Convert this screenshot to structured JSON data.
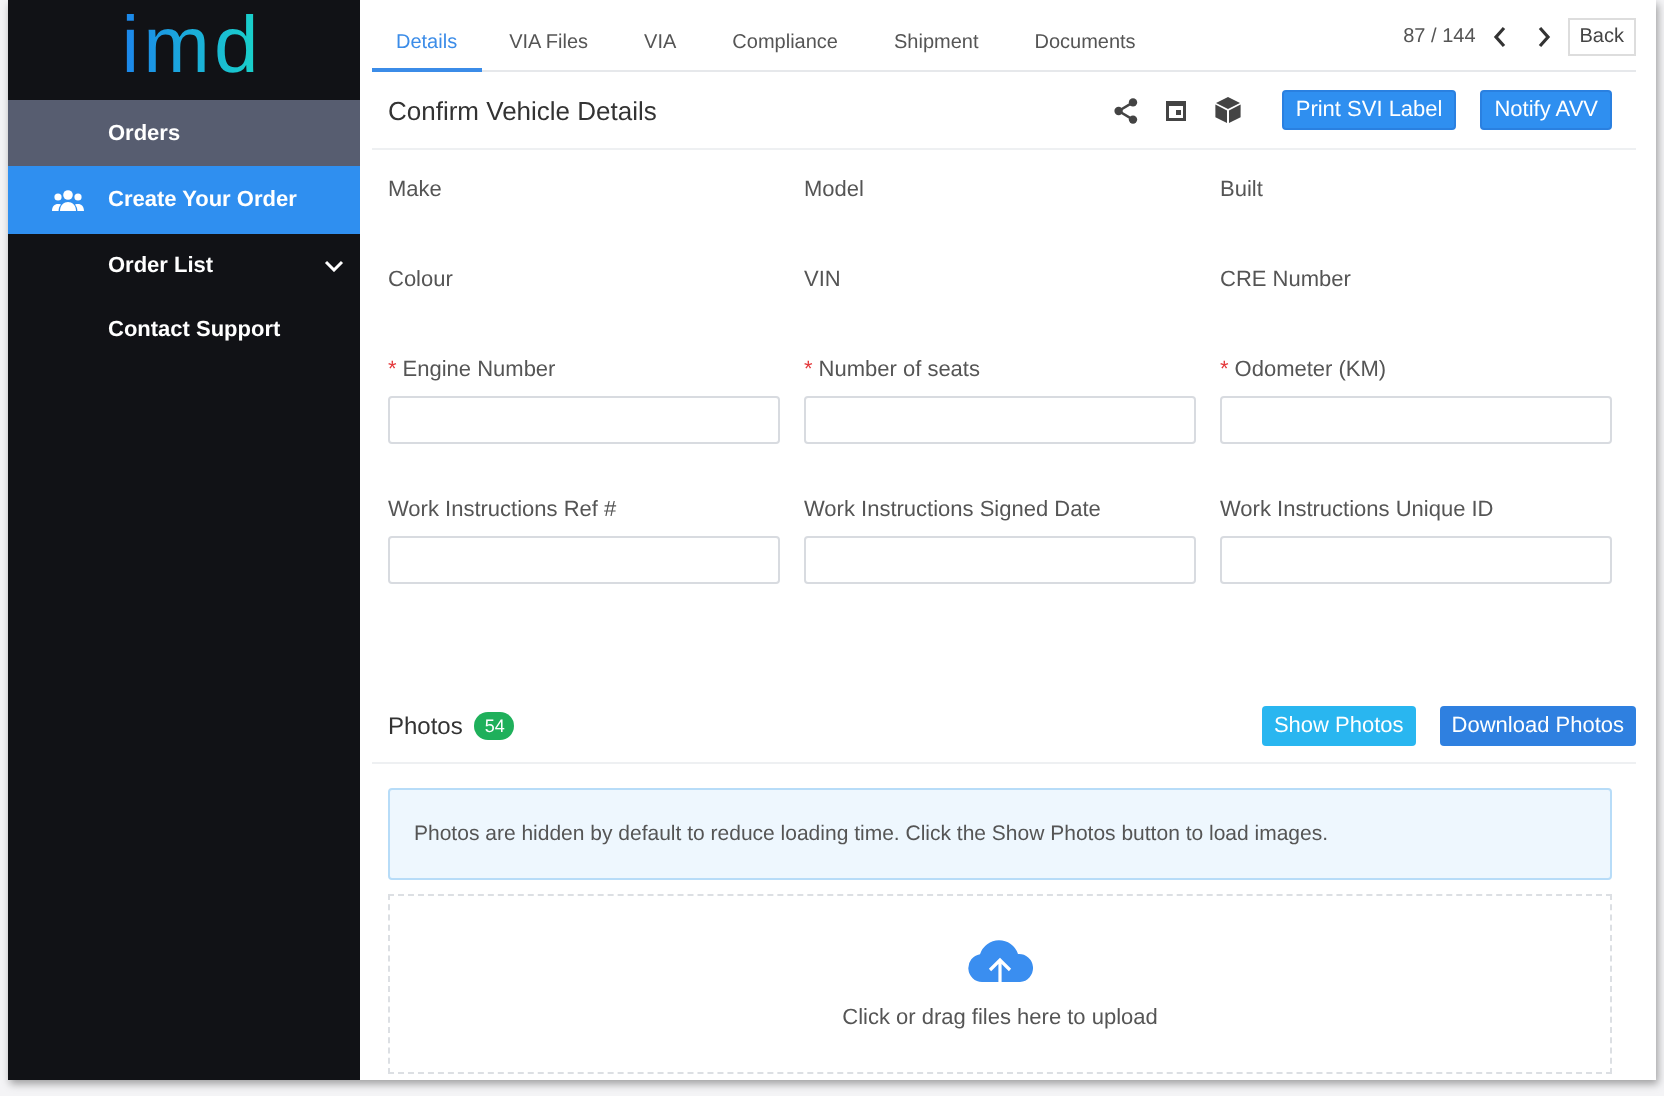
{
  "sidebar": {
    "logo": "imd",
    "items": [
      {
        "label": "Orders",
        "kind": "header",
        "selected": false
      },
      {
        "label": "Create Your Order",
        "kind": "icon-link",
        "selected": true
      },
      {
        "label": "Order List",
        "kind": "group",
        "selected": false,
        "expanded": false
      },
      {
        "label": "Contact Support",
        "kind": "link",
        "selected": false
      }
    ]
  },
  "tabs": [
    {
      "label": "Details",
      "selected": true
    },
    {
      "label": "VIA Files",
      "selected": false
    },
    {
      "label": "VIA",
      "selected": false
    },
    {
      "label": "Compliance",
      "selected": false
    },
    {
      "label": "Shipment",
      "selected": false
    },
    {
      "label": "Documents",
      "selected": false
    }
  ],
  "pager": {
    "position": "87 / 144",
    "back": "Back"
  },
  "header": {
    "title": "Confirm Vehicle Details",
    "buttons": [
      "Print SVI Label",
      "Notify AVV"
    ]
  },
  "fields": [
    {
      "label": "Make",
      "kind": "static",
      "required": false
    },
    {
      "label": "Model",
      "kind": "static",
      "required": false
    },
    {
      "label": "Built",
      "kind": "static",
      "required": false
    },
    {
      "label": "Colour",
      "kind": "static",
      "required": false
    },
    {
      "label": "VIN",
      "kind": "static",
      "required": false
    },
    {
      "label": "CRE Number",
      "kind": "static",
      "required": false
    },
    {
      "label": "Engine Number",
      "kind": "input",
      "required": true,
      "marker": "*"
    },
    {
      "label": "Number of seats",
      "kind": "input",
      "required": true,
      "marker": "*"
    },
    {
      "label": "Odometer (KM)",
      "kind": "input",
      "required": true,
      "marker": "*"
    },
    {
      "label": "Work Instructions Ref #",
      "kind": "input",
      "required": false
    },
    {
      "label": "Work Instructions Signed Date",
      "kind": "input",
      "required": false
    },
    {
      "label": "Work Instructions Unique ID",
      "kind": "input",
      "required": false
    }
  ],
  "photos": {
    "title": "Photos",
    "count": "54",
    "show_button": "Show Photos",
    "download_button": "Download Photos",
    "notice": "Photos are hidden by default to reduce loading time. Click the Show Photos button to load images.",
    "upload_text": "Click or drag files here to upload"
  }
}
